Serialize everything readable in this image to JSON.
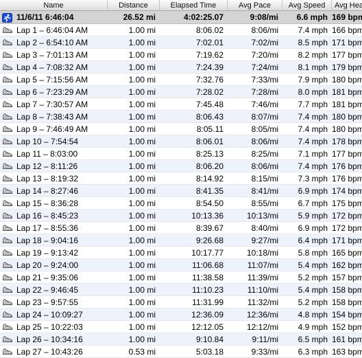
{
  "columns": [
    "Name",
    "Distance",
    "Elapsed Time",
    "Avg Pace",
    "Avg Speed",
    "Avg Hear…"
  ],
  "summary": {
    "name": "11/6/11 6:46:04",
    "distance": "26.52 mi",
    "elapsed": "4:02:25.07",
    "pace": "9:08/mi",
    "speed": "6.6 mph",
    "heart": "169 bpm",
    "icon": "runner-icon"
  },
  "laps": [
    {
      "name": "Lap 1 – 6:46:04 AM",
      "distance": "1.00 mi",
      "elapsed": "8:06.02",
      "pace": "8:06/mi",
      "speed": "7.4 mph",
      "heart": "166 bpm"
    },
    {
      "name": "Lap 2 – 6:54:10 AM",
      "distance": "1.00 mi",
      "elapsed": "7:02.01",
      "pace": "7:02/mi",
      "speed": "8.5 mph",
      "heart": "171 bpm"
    },
    {
      "name": "Lap 3 – 7:01:13 AM",
      "distance": "1.00 mi",
      "elapsed": "7:19.62",
      "pace": "7:20/mi",
      "speed": "8.2 mph",
      "heart": "177 bpm"
    },
    {
      "name": "Lap 4 – 7:08:32 AM",
      "distance": "1.00 mi",
      "elapsed": "7:24.39",
      "pace": "7:24/mi",
      "speed": "8.1 mph",
      "heart": "179 bpm"
    },
    {
      "name": "Lap 5 – 7:15:56 AM",
      "distance": "1.00 mi",
      "elapsed": "7:32.76",
      "pace": "7:33/mi",
      "speed": "7.9 mph",
      "heart": "180 bpm"
    },
    {
      "name": "Lap 6 – 7:23:29 AM",
      "distance": "1.00 mi",
      "elapsed": "7:28.02",
      "pace": "7:28/mi",
      "speed": "8.0 mph",
      "heart": "181 bpm"
    },
    {
      "name": "Lap 7 – 7:30:57 AM",
      "distance": "1.00 mi",
      "elapsed": "7:45.48",
      "pace": "7:46/mi",
      "speed": "7.7 mph",
      "heart": "181 bpm"
    },
    {
      "name": "Lap 8 – 7:38:43 AM",
      "distance": "1.00 mi",
      "elapsed": "8:06.43",
      "pace": "8:07/mi",
      "speed": "7.4 mph",
      "heart": "180 bpm"
    },
    {
      "name": "Lap 9 – 7:46:49 AM",
      "distance": "1.00 mi",
      "elapsed": "8:05.11",
      "pace": "8:05/mi",
      "speed": "7.4 mph",
      "heart": "180 bpm"
    },
    {
      "name": "Lap 10 – 7:54:54",
      "distance": "1.00 mi",
      "elapsed": "8:06.01",
      "pace": "8:06/mi",
      "speed": "7.4 mph",
      "heart": "178 bpm"
    },
    {
      "name": "Lap 11 – 8:03:00",
      "distance": "1.00 mi",
      "elapsed": "8:25.13",
      "pace": "8:25/mi",
      "speed": "7.1 mph",
      "heart": "177 bpm"
    },
    {
      "name": "Lap 12 – 8:11:26",
      "distance": "1.00 mi",
      "elapsed": "8:06.20",
      "pace": "8:06/mi",
      "speed": "7.4 mph",
      "heart": "176 bpm"
    },
    {
      "name": "Lap 13 – 8:19:32",
      "distance": "1.00 mi",
      "elapsed": "8:14.92",
      "pace": "8:15/mi",
      "speed": "7.3 mph",
      "heart": "176 bpm"
    },
    {
      "name": "Lap 14 – 8:27:46",
      "distance": "1.00 mi",
      "elapsed": "8:41.35",
      "pace": "8:41/mi",
      "speed": "6.9 mph",
      "heart": "174 bpm"
    },
    {
      "name": "Lap 15 – 8:36:28",
      "distance": "1.00 mi",
      "elapsed": "8:54.50",
      "pace": "8:55/mi",
      "speed": "6.7 mph",
      "heart": "175 bpm"
    },
    {
      "name": "Lap 16 – 8:45:23",
      "distance": "1.00 mi",
      "elapsed": "10:13.36",
      "pace": "10:13/mi",
      "speed": "5.9 mph",
      "heart": "172 bpm"
    },
    {
      "name": "Lap 17 – 8:55:36",
      "distance": "1.00 mi",
      "elapsed": "8:39.67",
      "pace": "8:40/mi",
      "speed": "6.9 mph",
      "heart": "172 bpm"
    },
    {
      "name": "Lap 18 – 9:04:16",
      "distance": "1.00 mi",
      "elapsed": "9:26.68",
      "pace": "9:27/mi",
      "speed": "6.4 mph",
      "heart": "171 bpm"
    },
    {
      "name": "Lap 19 – 9:13:42",
      "distance": "1.00 mi",
      "elapsed": "10:17.77",
      "pace": "10:18/mi",
      "speed": "5.8 mph",
      "heart": "165 bpm"
    },
    {
      "name": "Lap 20 – 9:24:00",
      "distance": "1.00 mi",
      "elapsed": "11:06.68",
      "pace": "11:07/mi",
      "speed": "5.4 mph",
      "heart": "162 bpm"
    },
    {
      "name": "Lap 21 – 9:35:06",
      "distance": "1.00 mi",
      "elapsed": "11:38.58",
      "pace": "11:39/mi",
      "speed": "5.2 mph",
      "heart": "157 bpm"
    },
    {
      "name": "Lap 22 – 9:46:45",
      "distance": "1.00 mi",
      "elapsed": "11:10.23",
      "pace": "11:10/mi",
      "speed": "5.4 mph",
      "heart": "158 bpm"
    },
    {
      "name": "Lap 23 – 9:57:55",
      "distance": "1.00 mi",
      "elapsed": "11:31.99",
      "pace": "11:32/mi",
      "speed": "5.2 mph",
      "heart": "158 bpm"
    },
    {
      "name": "Lap 24 – 10:09:27",
      "distance": "1.00 mi",
      "elapsed": "12:36.09",
      "pace": "12:36/mi",
      "speed": "4.8 mph",
      "heart": "154 bpm"
    },
    {
      "name": "Lap 25 – 10:22:03",
      "distance": "1.00 mi",
      "elapsed": "12:12.05",
      "pace": "12:12/mi",
      "speed": "4.9 mph",
      "heart": "152 bpm"
    },
    {
      "name": "Lap 26 – 10:34:16",
      "distance": "1.00 mi",
      "elapsed": "9:10.84",
      "pace": "9:11/mi",
      "speed": "6.5 mph",
      "heart": "161 bpm"
    },
    {
      "name": "Lap 27 – 10:43:26",
      "distance": "0.53 mi",
      "elapsed": "5:03.18",
      "pace": "9:33/mi",
      "speed": "6.3 mph",
      "heart": "163 bpm"
    }
  ],
  "icons": {
    "lap": "shoe-icon",
    "summary": "runner-icon"
  },
  "colors": {
    "alt_row": "#eef3fb",
    "summary_row": "#d4d4d4",
    "header_top": "#fbfbfb",
    "header_bottom": "#dcdcdc",
    "runner_icon": "#1d4fd8"
  }
}
